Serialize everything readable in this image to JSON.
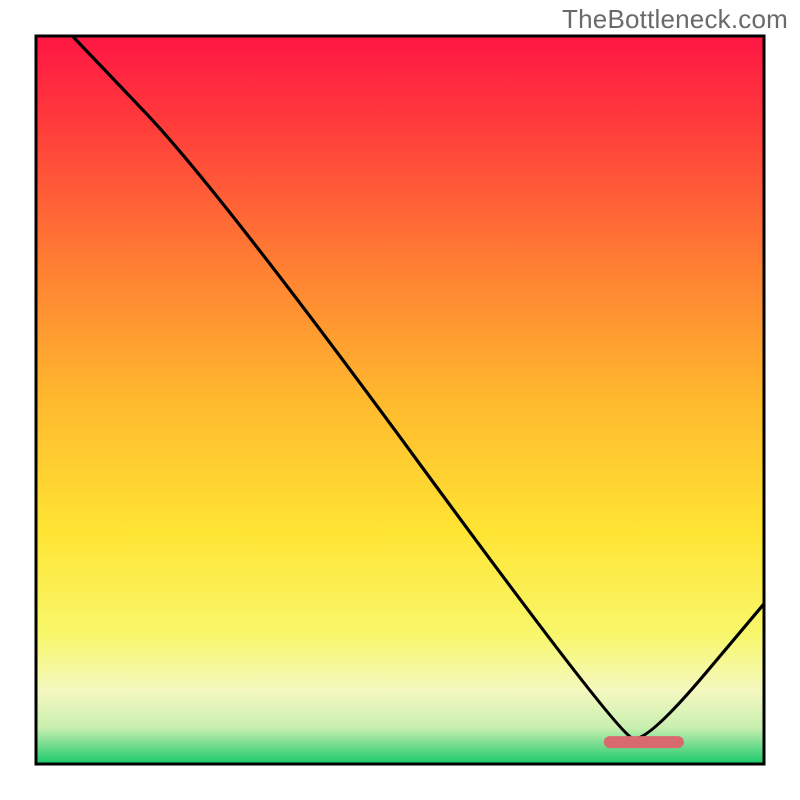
{
  "watermark": "TheBottleneck.com",
  "chart_data": {
    "type": "line",
    "title": "",
    "xlabel": "",
    "ylabel": "",
    "xlim": [
      0,
      100
    ],
    "ylim": [
      0,
      100
    ],
    "curve_points_xy": [
      [
        5,
        100
      ],
      [
        25,
        79
      ],
      [
        80,
        4
      ],
      [
        84,
        3
      ],
      [
        100,
        22
      ]
    ],
    "optimum_band_x": [
      78,
      89
    ],
    "optimum_y": 3,
    "gradient_stops": [
      {
        "pos": 0.0,
        "color": "#ff1744"
      },
      {
        "pos": 0.12,
        "color": "#ff3b3b"
      },
      {
        "pos": 0.3,
        "color": "#ff7a33"
      },
      {
        "pos": 0.5,
        "color": "#ffb92e"
      },
      {
        "pos": 0.68,
        "color": "#ffe433"
      },
      {
        "pos": 0.82,
        "color": "#f8f76a"
      },
      {
        "pos": 0.9,
        "color": "#f4f8c0"
      },
      {
        "pos": 0.95,
        "color": "#c9efb0"
      },
      {
        "pos": 1.0,
        "color": "#18c96b"
      }
    ],
    "marker_color": "#d86a6e"
  }
}
